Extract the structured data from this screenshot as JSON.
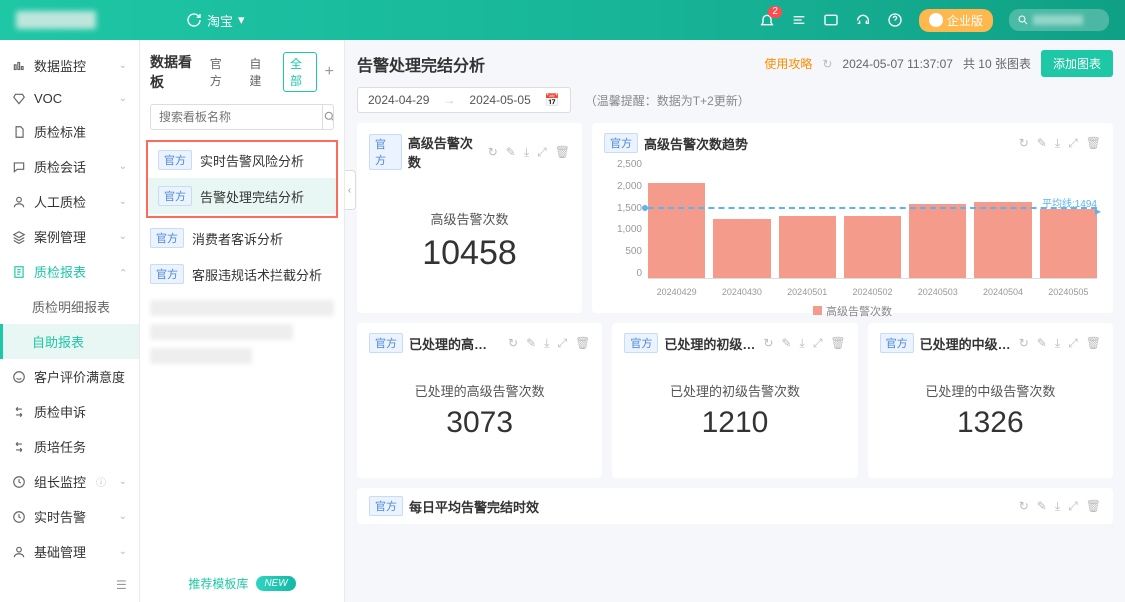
{
  "top": {
    "brand": "淘宝",
    "enterprise": "企业版",
    "badge_count": "2"
  },
  "nav": {
    "items": [
      {
        "label": "数据监控",
        "icon": "chart-bar"
      },
      {
        "label": "VOC",
        "icon": "diamond"
      },
      {
        "label": "质检标准",
        "icon": "file"
      },
      {
        "label": "质检会话",
        "icon": "chat"
      },
      {
        "label": "人工质检",
        "icon": "user"
      },
      {
        "label": "案例管理",
        "icon": "layers"
      },
      {
        "label": "质检报表",
        "icon": "report",
        "expanded": true
      },
      {
        "label": "客户评价满意度",
        "icon": "smile"
      },
      {
        "label": "质检申诉",
        "icon": "arrows"
      },
      {
        "label": "质培任务",
        "icon": "arrows"
      },
      {
        "label": "组长监控",
        "icon": "clock"
      },
      {
        "label": "实时告警",
        "icon": "clock"
      },
      {
        "label": "基础管理",
        "icon": "user"
      }
    ],
    "sub": [
      {
        "label": "质检明细报表"
      },
      {
        "label": "自助报表",
        "active": true
      }
    ]
  },
  "panel2": {
    "title": "数据看板",
    "tabs": [
      "官方",
      "自建",
      "全部"
    ],
    "active_tab": 2,
    "search_placeholder": "搜索看板名称",
    "tag": "官方",
    "dashboards": [
      {
        "name": "实时告警风险分析",
        "highlighted": true
      },
      {
        "name": "告警处理完结分析",
        "highlighted": true,
        "selected": true
      },
      {
        "name": "消费者客诉分析"
      },
      {
        "name": "客服违规话术拦截分析"
      }
    ],
    "footer": "推荐模板库",
    "footer_pill": "NEW"
  },
  "main": {
    "title": "告警处理完结分析",
    "guide": "使用攻略",
    "timestamp": "2024-05-07 11:37:07",
    "count_text": "共 10 张图表",
    "add_button": "添加图表",
    "date_start": "2024-04-29",
    "date_end": "2024-05-05",
    "tip": "（温馨提醒：数据为T+2更新）",
    "cards": {
      "kpi_main": {
        "title": "高级告警次数",
        "label": "高级告警次数",
        "value": "10458"
      },
      "trend": {
        "title": "高级告警次数趋势",
        "avg_label": "平均线:1494",
        "legend": "高级告警次数"
      },
      "kpi1": {
        "title": "已处理的高…",
        "label": "已处理的高级告警次数",
        "value": "3073"
      },
      "kpi2": {
        "title": "已处理的初级…",
        "label": "已处理的初级告警次数",
        "value": "1210"
      },
      "kpi3": {
        "title": "已处理的中级…",
        "label": "已处理的中级告警次数",
        "value": "1326"
      },
      "wide": {
        "title": "每日平均告警完结时效"
      }
    }
  },
  "chart_data": {
    "type": "bar",
    "categories": [
      "20240429",
      "20240430",
      "20240501",
      "20240502",
      "20240503",
      "20240504",
      "20240505"
    ],
    "values": [
      2000,
      1250,
      1300,
      1300,
      1550,
      1600,
      1450
    ],
    "title": "高级告警次数趋势",
    "xlabel": "",
    "ylabel": "",
    "ylim": [
      0,
      2500
    ],
    "yticks": [
      0,
      500,
      1000,
      1500,
      2000,
      2500
    ],
    "avg": 1494,
    "series_name": "高级告警次数"
  }
}
